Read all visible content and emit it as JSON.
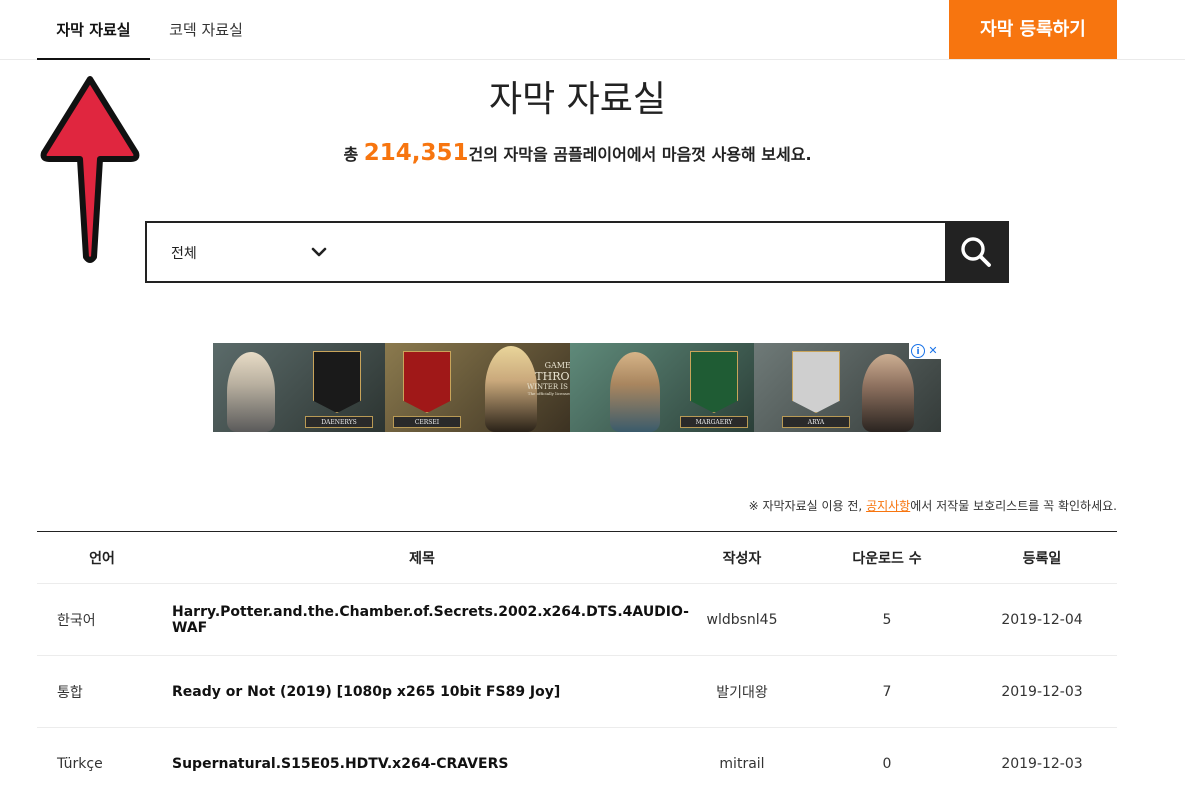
{
  "tabs": [
    {
      "label": "자막 자료실"
    },
    {
      "label": "코덱 자료실"
    }
  ],
  "register_button": "자막 등록하기",
  "page_title": "자막 자료실",
  "summary": {
    "prefix": "총 ",
    "count": "214,351",
    "suffix": "건의 자막을 곰플레이어에서 마음껏 사용해 보세요."
  },
  "search": {
    "category": "전체",
    "placeholder": ""
  },
  "ad": {
    "names": [
      "DAENERYS",
      "CERSEI",
      "MARGAERY",
      "ARYA"
    ],
    "logo_line1": "GAME OF",
    "logo_line2": "THRONES",
    "logo_line3": "WINTER IS COMING",
    "logo_line4": "The officially licensed browser game",
    "info": "i",
    "close": "✕"
  },
  "notice": {
    "prefix": "※ 자막자료실 이용 전, ",
    "link": "공지사항",
    "suffix": "에서 저작물 보호리스트를 꼭 확인하세요."
  },
  "table": {
    "headers": {
      "lang": "언어",
      "title": "제목",
      "author": "작성자",
      "downloads": "다운로드 수",
      "date": "등록일"
    },
    "rows": [
      {
        "lang": "한국어",
        "title": "Harry.Potter.and.the.Chamber.of.Secrets.2002.x264.DTS.4AUDIO-WAF",
        "author": "wldbsnl45",
        "downloads": "5",
        "date": "2019-12-04"
      },
      {
        "lang": "통합",
        "title": "Ready or Not (2019) [1080p x265 10bit FS89 Joy]",
        "author": "발기대왕",
        "downloads": "7",
        "date": "2019-12-03"
      },
      {
        "lang": "Türkçe",
        "title": "Supernatural.S15E05.HDTV.x264-CRAVERS",
        "author": "mitrail",
        "downloads": "0",
        "date": "2019-12-03"
      }
    ]
  },
  "colors": {
    "accent": "#f7750f",
    "dark": "#222222",
    "arrow_fill": "#e0263f"
  }
}
